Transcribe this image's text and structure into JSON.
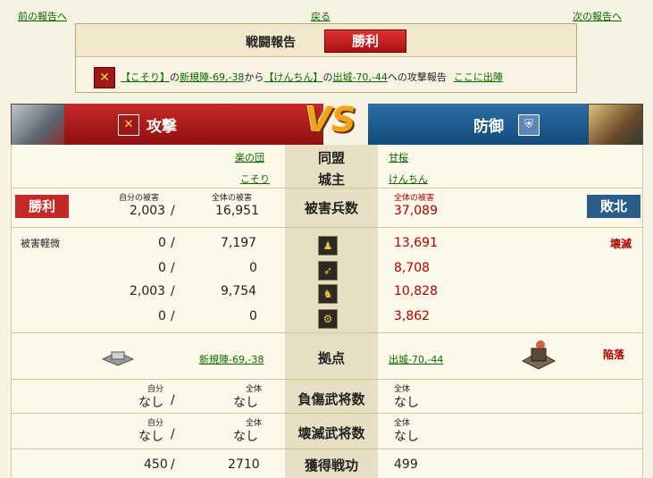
{
  "nav": {
    "prev": "前の報告へ",
    "back": "戻る",
    "next": "次の報告へ"
  },
  "header": {
    "title": "戦闘報告",
    "result": "勝利",
    "report": {
      "attacker": "【こそり】",
      "p1": "の",
      "from_base": "新規陣-69,-38",
      "p2": "から",
      "defender": "【けんちん】",
      "p3": "の",
      "to_base": "出城-70,-44",
      "p4": "への攻撃報告",
      "sortie_link": "ここに出陣"
    }
  },
  "vs": {
    "attack_label": "攻撃",
    "defense_label": "防御",
    "vs_text": "VS"
  },
  "rows": {
    "alliance": {
      "label": "同盟",
      "attacker": "楽の団",
      "defender": "甘桜"
    },
    "lord": {
      "label": "城主",
      "attacker": "こそり",
      "defender": "けんちん"
    },
    "casualties": {
      "label": "被害兵数",
      "own_caption": "自分の被害",
      "total_caption": "全体の被害",
      "def_caption": "全体の被害",
      "atk_own": "2,003",
      "atk_total": "16,951",
      "def_total": "37,089",
      "atk_result": "勝利",
      "def_result": "敗北"
    },
    "units": [
      {
        "icon": "foot-soldier-icon",
        "own": "0",
        "total": "7,197",
        "def": "13,691"
      },
      {
        "icon": "bow-icon",
        "own": "0",
        "total": "0",
        "def": "8,708"
      },
      {
        "icon": "horse-icon",
        "own": "2,003",
        "total": "9,754",
        "def": "10,828"
      },
      {
        "icon": "siege-icon",
        "own": "0",
        "total": "0",
        "def": "3,862"
      }
    ],
    "damage_note": "被害軽微",
    "destroyed_note": "壊滅",
    "base": {
      "label": "拠点",
      "attacker": "新規陣-69,-38",
      "defender": "出城-70,-44",
      "fallen": "陥落"
    },
    "injured": {
      "label": "負傷武将数",
      "own_caption": "自分",
      "total_caption": "全体",
      "def_caption": "全体",
      "own": "なし",
      "total": "なし",
      "def": "なし"
    },
    "destroyed": {
      "label": "壊滅武将数",
      "own_caption": "自分",
      "total_caption": "全体",
      "def_caption": "全体",
      "own": "なし",
      "total": "なし",
      "def": "なし"
    },
    "merit": {
      "label": "獲得戦功",
      "own": "450",
      "total": "2710",
      "def": "499"
    }
  },
  "slash": "/",
  "colors": {
    "attack": "#b71c1c",
    "defense": "#1f5d93",
    "win": "#c62828",
    "lose": "#2a5d8a",
    "link": "#0a6a00"
  }
}
